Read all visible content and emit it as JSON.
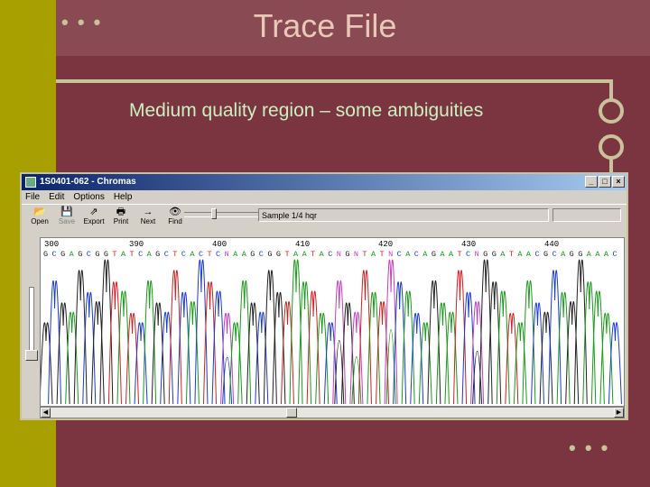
{
  "slide": {
    "title": "Trace File",
    "subtitle": "Medium quality region – some ambiguities",
    "dots_top": "• • •",
    "dots_bottom": "• • •",
    "colors": {
      "background": "#7a3540",
      "left_band": "#a8a000",
      "accent": "#c9c29a",
      "title": "#e8c9b8"
    }
  },
  "window": {
    "title": "1S0401-062 - Chromas",
    "controls": [
      "_",
      "□",
      "×"
    ],
    "menu": [
      "File",
      "Edit",
      "Options",
      "Help"
    ],
    "toolbar": [
      {
        "label": "Open",
        "icon": "open-folder-icon",
        "glyph": "📂",
        "enabled": true
      },
      {
        "label": "Save",
        "icon": "save-disk-icon",
        "glyph": "💾",
        "enabled": false
      },
      {
        "label": "Export",
        "icon": "export-icon",
        "glyph": "⇗",
        "enabled": true
      },
      {
        "label": "Print",
        "icon": "printer-icon",
        "glyph": "🖶",
        "enabled": true
      },
      {
        "label": "Next",
        "icon": "next-arrow-icon",
        "glyph": "→",
        "enabled": true
      },
      {
        "label": "Find",
        "icon": "binoculars-icon",
        "glyph": "👁",
        "enabled": true
      }
    ],
    "sample_field": "Sample 1/4 hqr",
    "positions": [
      "390",
      "400",
      "410",
      "420",
      "430",
      "440"
    ],
    "start_position": "300",
    "sequence": "G C G A G C G G T A T C A G C T C A C T C N A A G C G G T A A T A C N G N T A T N C A C A G A A T C N G G A T A A C G C A G G A A A C"
  }
}
